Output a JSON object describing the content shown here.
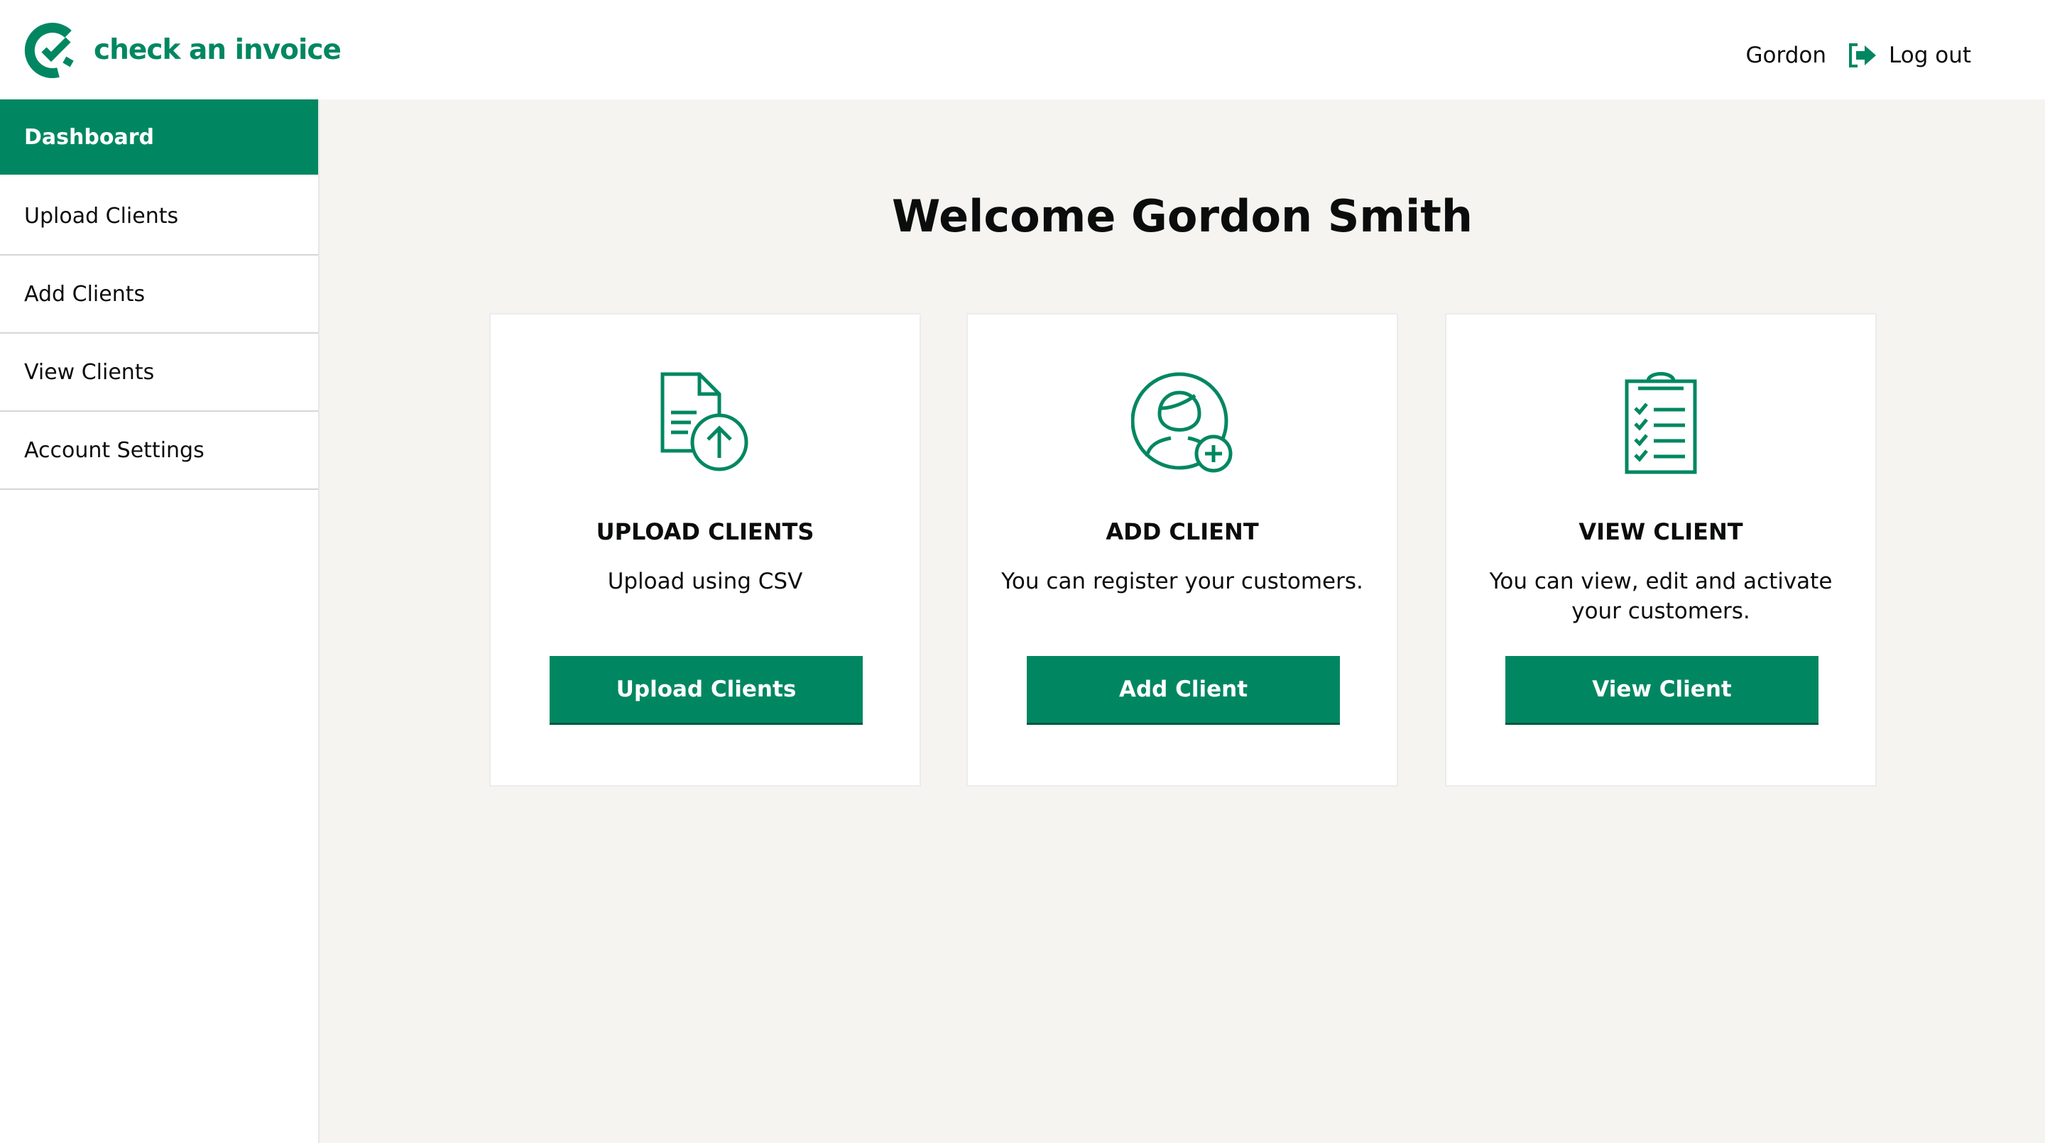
{
  "header": {
    "logo_text": "check an invoice",
    "user": "Gordon",
    "logout": "Log out"
  },
  "sidebar": {
    "items": [
      {
        "label": "Dashboard"
      },
      {
        "label": "Upload Clients"
      },
      {
        "label": "Add Clients"
      },
      {
        "label": "View Clients"
      },
      {
        "label": "Account Settings"
      }
    ]
  },
  "main": {
    "title": "Welcome Gordon Smith",
    "cards": [
      {
        "heading": "UPLOAD CLIENTS",
        "description": "Upload using CSV",
        "button": "Upload Clients",
        "icon": "file-upload-icon"
      },
      {
        "heading": "ADD CLIENT",
        "description": "You can register your customers.",
        "button": "Add Client",
        "icon": "add-user-icon"
      },
      {
        "heading": "VIEW CLIENT",
        "description": "You can view, edit and activate your customers.",
        "button": "View Client",
        "icon": "clipboard-checklist-icon"
      }
    ]
  },
  "colors": {
    "brand": "#008761"
  }
}
